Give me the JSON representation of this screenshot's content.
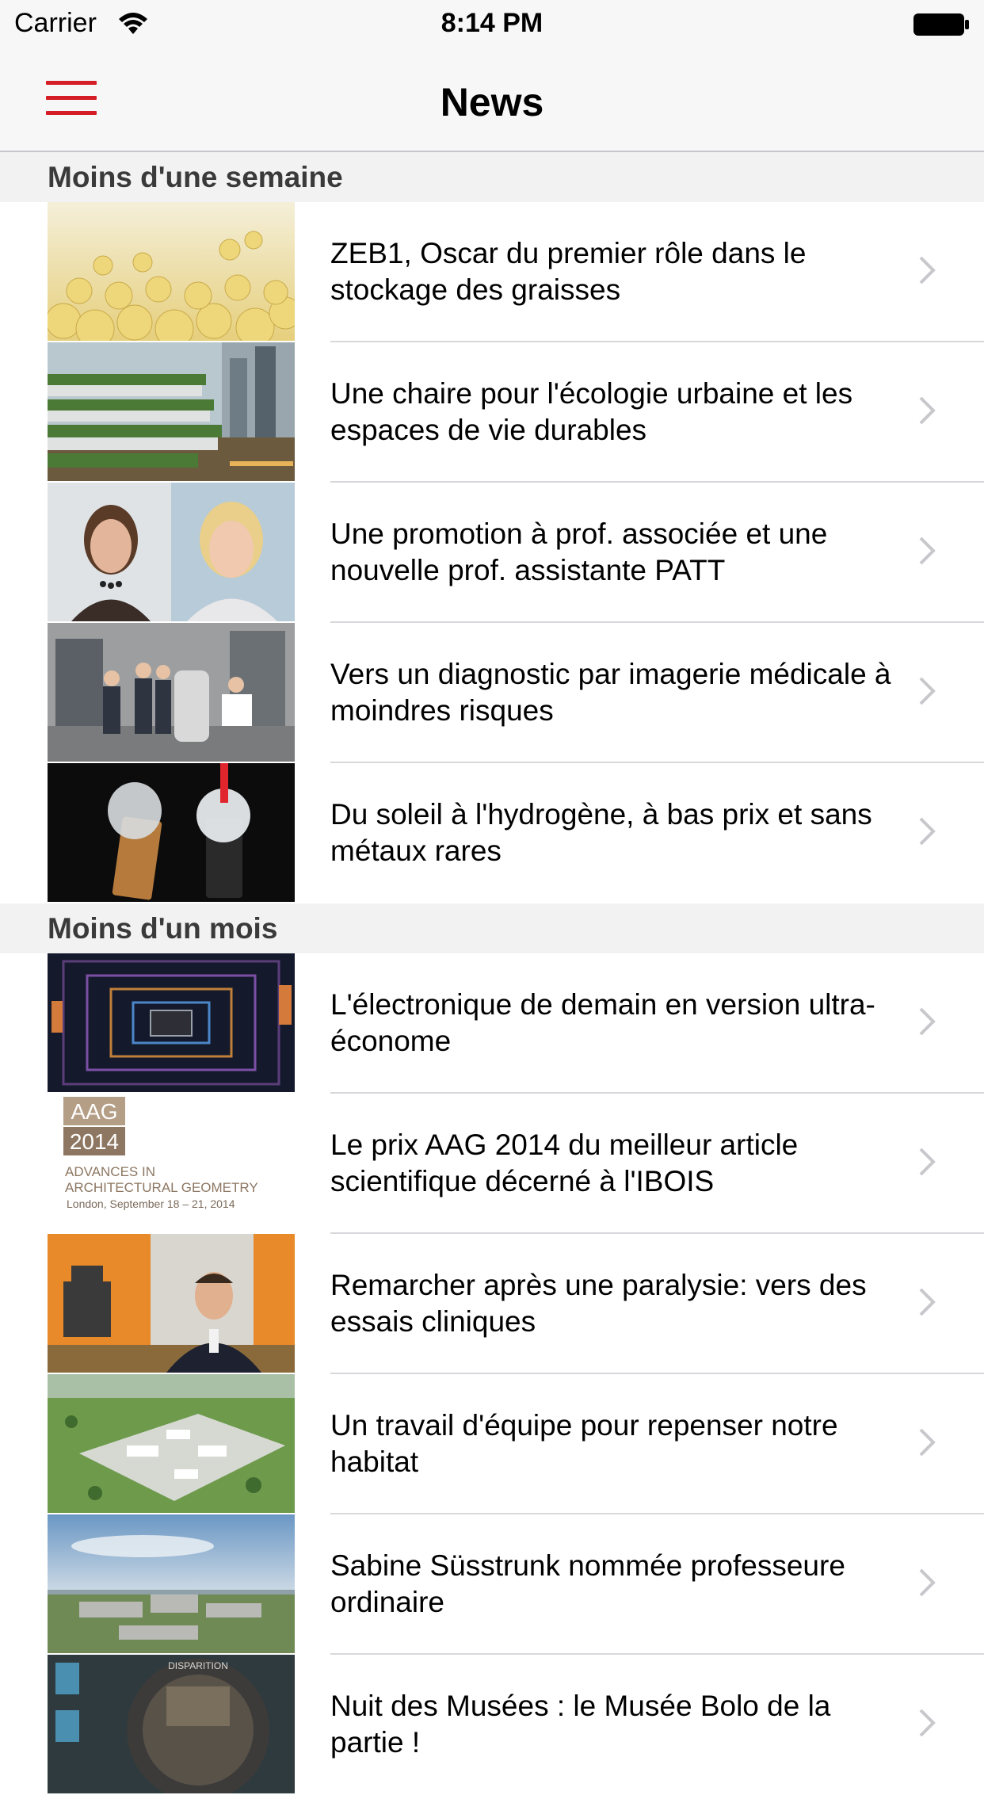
{
  "status_bar": {
    "carrier": "Carrier",
    "time": "8:14 PM"
  },
  "nav": {
    "title": "News"
  },
  "sections": [
    {
      "header": "Moins d'une semaine",
      "items": [
        {
          "title": "ZEB1, Oscar du premier rôle dans le stockage des graisses"
        },
        {
          "title": "Une chaire pour l'écologie urbaine et les espaces de vie durables"
        },
        {
          "title": "Une promotion à prof. associée et une nouvelle prof. assistante  PATT"
        },
        {
          "title": "Vers un diagnostic par imagerie médicale à moindres risques"
        },
        {
          "title": "Du soleil à l'hydrogène, à bas prix et sans métaux rares"
        }
      ]
    },
    {
      "header": "Moins d'un mois",
      "items": [
        {
          "title": "L'électronique de demain en version ultra-économe"
        },
        {
          "title": "Le prix AAG 2014 du meilleur article scientifique décerné à l'IBOIS"
        },
        {
          "title": "Remarcher après une paralysie: vers des essais cliniques"
        },
        {
          "title": "Un travail d'équipe pour repenser notre habitat"
        },
        {
          "title": "Sabine Süsstrunk nommée professeure ordinaire"
        },
        {
          "title": "Nuit des Musées : le Musée Bolo de la partie !"
        }
      ]
    }
  ],
  "thumb_text": {
    "aag_badge_top": "AAG",
    "aag_badge_bottom": "2014",
    "aag_line1": "ADVANCES IN",
    "aag_line2": "ARCHITECTURAL GEOMETRY",
    "aag_line3": "London, September 18 – 21, 2014",
    "museum_label": "DISPARITION"
  },
  "colors": {
    "accent": "#d41d24",
    "chevron": "#c7c7cc",
    "separator": "#d8d8dc",
    "section_bg": "#f2f2f3"
  }
}
